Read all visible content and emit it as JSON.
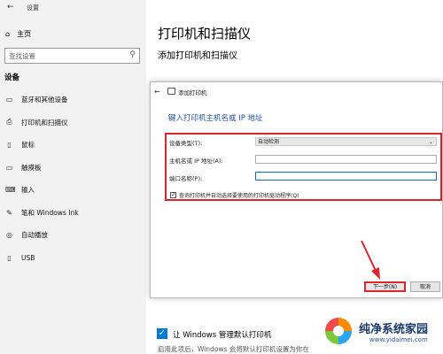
{
  "window": {
    "title": "设置",
    "back_icon": "back-arrow-icon"
  },
  "sidebar": {
    "home_label": "主页",
    "search_placeholder": "查找设置",
    "section_title": "设备",
    "items": [
      {
        "label": "蓝牙和其他设备",
        "icon": "bluetooth-devices-icon"
      },
      {
        "label": "打印机和扫描仪",
        "icon": "printer-icon"
      },
      {
        "label": "鼠标",
        "icon": "mouse-icon"
      },
      {
        "label": "触摸板",
        "icon": "touchpad-icon"
      },
      {
        "label": "输入",
        "icon": "keyboard-icon"
      },
      {
        "label": "笔和 Windows Ink",
        "icon": "pen-icon"
      },
      {
        "label": "自动播放",
        "icon": "autoplay-icon"
      },
      {
        "label": "USB",
        "icon": "usb-icon"
      }
    ]
  },
  "main": {
    "title": "打印机和扫描仪",
    "subtitle": "添加打印机和扫描仪",
    "default_printer_label": "让 Windows 管理默认打印机",
    "default_printer_checked": true,
    "default_printer_desc": "启用此项后，Windows 会将默认打印机设置为你在"
  },
  "dialog": {
    "title": "添加打印机",
    "heading": "键入打印机主机名或 IP 地址",
    "device_type_label": "设备类型(T):",
    "device_type_value": "自动检测",
    "host_label": "主机名或 IP 地址(A):",
    "host_value": "",
    "port_label": "端口名称(P):",
    "port_value": "",
    "query_label": "查询打印机并自动选择要使用的打印机驱动程序(Q)",
    "query_checked": true,
    "next_label": "下一步(N)",
    "cancel_label": "取消"
  },
  "watermark": {
    "text": "纯净系统家园",
    "url": "www.yidaimei.com"
  },
  "colors": {
    "highlight_red": "#d9262e",
    "accent_blue": "#0078d7",
    "heading_blue": "#1f4e9e"
  }
}
